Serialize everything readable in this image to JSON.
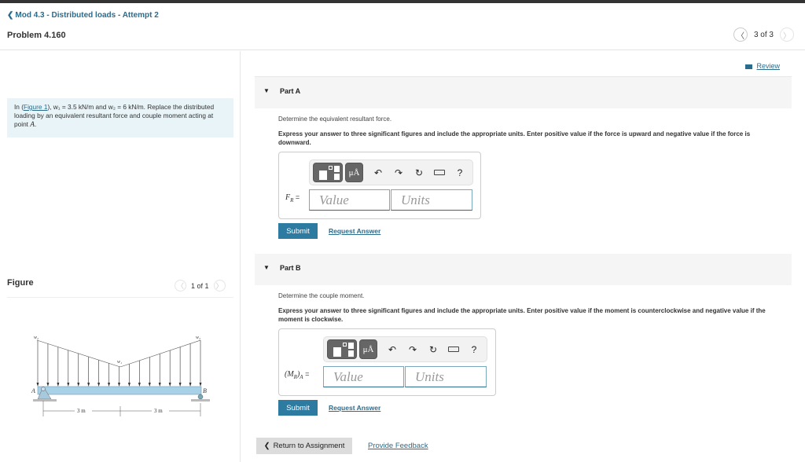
{
  "header": {
    "back_link": "Mod 4.3 - Distributed loads - Attempt 2",
    "problem_title": "Problem 4.160",
    "pager": {
      "text": "3 of 3"
    }
  },
  "intro": {
    "prefix": "In (",
    "figure_link": "Figure 1",
    "w1_expr": "), w₁ = 3.5 kN/m and ",
    "w2_expr": "w₂ = 6 kN/m",
    "rest": ". Replace the distributed loading by an equivalent resultant force and couple moment acting at point ",
    "point": "A",
    "end": "."
  },
  "figure": {
    "title": "Figure",
    "pager": "1 of 1",
    "labels": {
      "w2_left": "w₂",
      "w1": "w₁",
      "w2_right": "w₂",
      "A": "A",
      "B": "B",
      "dim1": "3 m",
      "dim2": "3 m"
    }
  },
  "review": {
    "label": "Review"
  },
  "parts": [
    {
      "label": "Part A",
      "question": "Determine the equivalent resultant force.",
      "instructions": "Express your answer to three significant figures and include the appropriate units. Enter positive value if the force is upward and negative value if the force is downward.",
      "field_label": "F",
      "field_sub": "R",
      "value_placeholder": "Value",
      "units_placeholder": "Units",
      "submit": "Submit",
      "request_answer": "Request Answer"
    },
    {
      "label": "Part B",
      "question": "Determine the couple moment.",
      "instructions": "Express your answer to three significant figures and include the appropriate units. Enter positive value if the moment is counterclockwise and negative value if the moment is clockwise.",
      "field_label": "(M",
      "field_sub": "R",
      "field_suffix": ")",
      "field_sub2": "A",
      "value_placeholder": "Value",
      "units_placeholder": "Units",
      "submit": "Submit",
      "request_answer": "Request Answer"
    }
  ],
  "toolbar": {
    "mu_label": "μÅ",
    "help": "?"
  },
  "footer": {
    "return": "Return to Assignment",
    "feedback": "Provide Feedback"
  }
}
